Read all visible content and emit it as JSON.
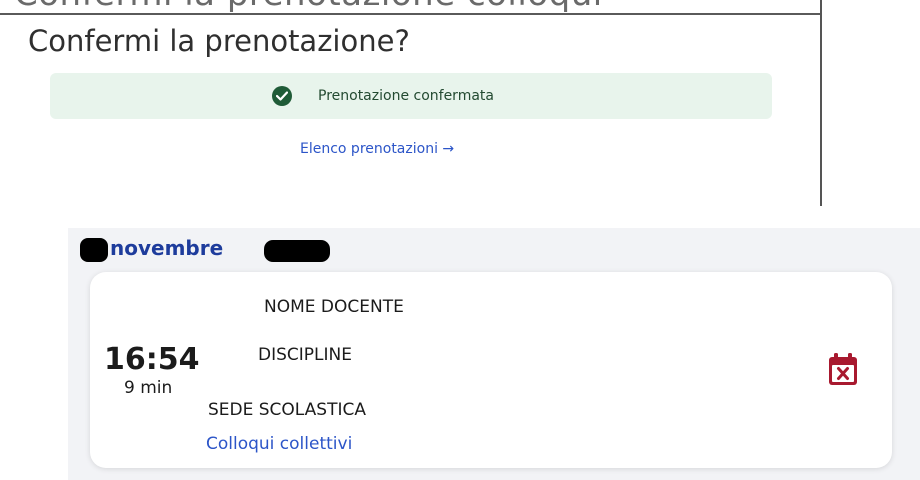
{
  "confirm_panel": {
    "title": "Confermi la prenotazione?",
    "status_message": "Prenotazione confermata",
    "bookings_link": "Elenco prenotazioni →",
    "cut_off_text": "Confermi la prenotazione colloqui"
  },
  "booking": {
    "date_month": "novembre",
    "time": "16:54",
    "duration": "9 min",
    "teacher": "NOME DOCENTE",
    "discipline": "DISCIPLINE",
    "school": "SEDE SCOLASTICA",
    "type_link": "Colloqui collettivi"
  },
  "icons": {
    "success": "check-circle-icon",
    "cancel": "calendar-remove-icon"
  },
  "colors": {
    "success_bg": "#e8f4ec",
    "success_icon": "#1f5b37",
    "link": "#2c55c8",
    "date_heading": "#1e3c9c",
    "cancel_icon": "#a8192f",
    "panel_bg": "#f2f3f6"
  }
}
